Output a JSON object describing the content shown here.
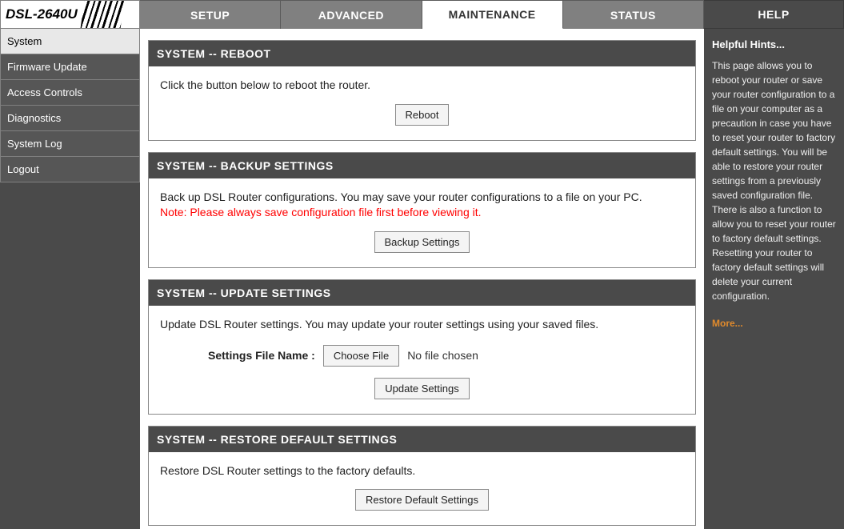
{
  "logo": {
    "model": "DSL-2640U"
  },
  "tabs": {
    "setup": "SETUP",
    "advanced": "ADVANCED",
    "maintenance": "MAINTENANCE",
    "status": "STATUS",
    "help": "HELP"
  },
  "sidebar": {
    "system": "System",
    "firmware": "Firmware Update",
    "access": "Access Controls",
    "diagnostics": "Diagnostics",
    "syslog": "System Log",
    "logout": "Logout"
  },
  "panels": {
    "reboot": {
      "title": "SYSTEM -- REBOOT",
      "text": "Click the button below to reboot the router.",
      "button": "Reboot"
    },
    "backup": {
      "title": "SYSTEM -- BACKUP SETTINGS",
      "text": "Back up DSL Router configurations. You may save your router configurations to a file on your PC.",
      "note": "Note: Please always save configuration file first before viewing it.",
      "button": "Backup Settings"
    },
    "update": {
      "title": "SYSTEM -- UPDATE SETTINGS",
      "text": "Update DSL Router settings. You may update your router settings using your saved files.",
      "file_label": "Settings File Name :",
      "choose_button": "Choose File",
      "file_status": "No file chosen",
      "button": "Update Settings"
    },
    "restore": {
      "title": "SYSTEM -- RESTORE DEFAULT SETTINGS",
      "text": "Restore DSL Router settings to the factory defaults.",
      "button": "Restore Default Settings"
    }
  },
  "help": {
    "title": "Helpful Hints...",
    "text": "This page allows you to reboot your router or save your router configuration to a file on your computer as a precaution in case you have to reset your router to factory default settings. You will be able to restore your router settings from a previously saved configuration file. There is also a function to allow you to reset your router to factory default settings. Resetting your router to factory default settings will delete your current configuration.",
    "more": "More..."
  }
}
